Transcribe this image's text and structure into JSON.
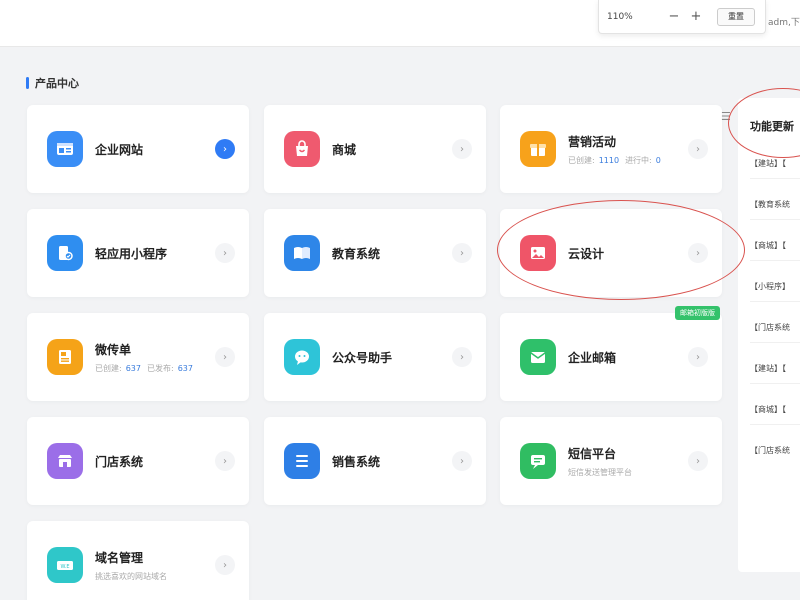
{
  "topbar": {
    "zoom_level": "110%",
    "zoom_minus": "−",
    "zoom_plus": "+",
    "reset_label": "重置",
    "user_text": "adm,下"
  },
  "section": {
    "title": "产品中心"
  },
  "cards": {
    "website": {
      "name": "企业网站",
      "arrow": "›"
    },
    "mall": {
      "name": "商城",
      "arrow": "›"
    },
    "marketing": {
      "name": "营销活动",
      "created_label": "已创建:",
      "created": "1110",
      "running_label": "进行中:",
      "running": "0",
      "arrow": "›"
    },
    "miniprogram": {
      "name": "轻应用小程序",
      "arrow": "›"
    },
    "education": {
      "name": "教育系统",
      "arrow": "›"
    },
    "design": {
      "name": "云设计",
      "arrow": "›"
    },
    "flyer": {
      "name": "微传单",
      "created_label": "已创建:",
      "created": "637",
      "published_label": "已发布:",
      "published": "637",
      "arrow": "›"
    },
    "wechat": {
      "name": "公众号助手",
      "arrow": "›"
    },
    "mail": {
      "name": "企业邮箱",
      "badge": "邮箱初版版",
      "arrow": "›"
    },
    "store": {
      "name": "门店系统",
      "arrow": "›"
    },
    "sales": {
      "name": "销售系统",
      "arrow": "›"
    },
    "sms": {
      "name": "短信平台",
      "sub": "短信发送管理平台",
      "arrow": "›"
    },
    "domain": {
      "name": "域名管理",
      "sub": "挑选喜欢的网站域名",
      "arrow": "›"
    }
  },
  "side_panel": {
    "menu_icon": "☰",
    "title": "功能更新",
    "items": [
      "【建站】【",
      "【教育系统",
      "【商城】【",
      "【小程序】",
      "【门店系统",
      "【建站】【",
      "【商城】【",
      "【门店系统"
    ]
  },
  "colors": {
    "accent": "#2f7bf5",
    "annotation": "#d9534f",
    "badge": "#34c26b"
  }
}
